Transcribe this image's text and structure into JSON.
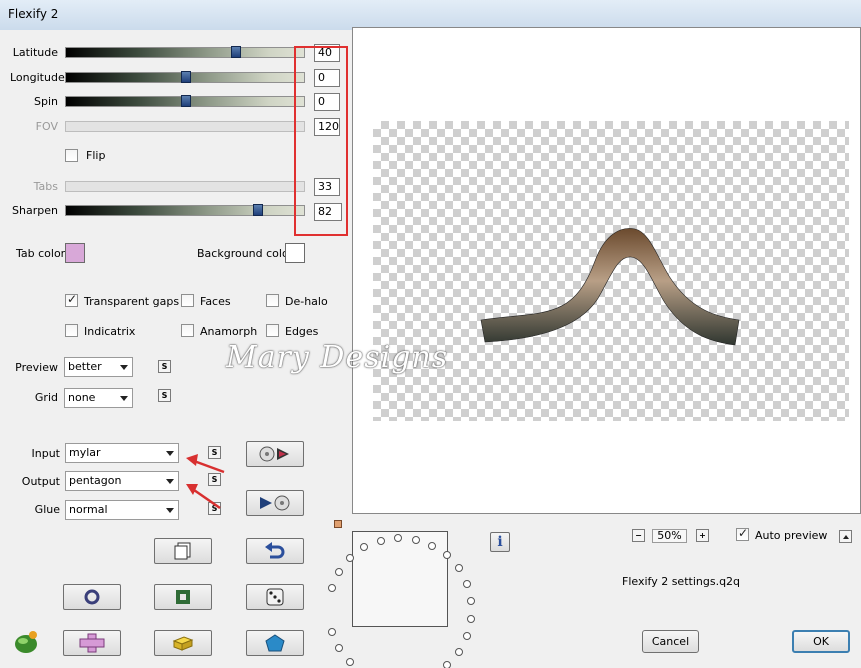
{
  "window": {
    "title": "Flexify 2"
  },
  "sliders": [
    {
      "label": "Latitude",
      "value": "40",
      "enabled": true,
      "level": 0.72
    },
    {
      "label": "Longitude",
      "value": "0",
      "enabled": true,
      "level": 0.5
    },
    {
      "label": "Spin",
      "value": "0",
      "enabled": true,
      "level": 0.5
    },
    {
      "label": "FOV",
      "value": "120",
      "enabled": false
    },
    {
      "label": "Tabs",
      "value": "33",
      "enabled": false
    },
    {
      "label": "Sharpen",
      "value": "82",
      "enabled": true,
      "level": 0.82
    }
  ],
  "flip": {
    "label": "Flip",
    "checked": false
  },
  "colors": {
    "tab_label": "Tab color",
    "tab_swatch": "#d8a8d8",
    "bg_label": "Background color",
    "bg_swatch": "#ffffff",
    "annotation": "#e03030"
  },
  "options": {
    "transparent_gaps": {
      "label": "Transparent gaps",
      "checked": true
    },
    "faces": {
      "label": "Faces",
      "checked": false
    },
    "de_halo": {
      "label": "De-halo",
      "checked": false
    },
    "indicatrix": {
      "label": "Indicatrix",
      "checked": false
    },
    "anamorph": {
      "label": "Anamorph",
      "checked": false
    },
    "edges": {
      "label": "Edges",
      "checked": false
    }
  },
  "preview_select": {
    "label": "Preview",
    "value": "better"
  },
  "grid_select": {
    "label": "Grid",
    "value": "none"
  },
  "input_select": {
    "label": "Input",
    "value": "mylar"
  },
  "output_select": {
    "label": "Output",
    "value": "pentagon"
  },
  "glue_select": {
    "label": "Glue",
    "value": "normal"
  },
  "s_button": "S",
  "zoom": {
    "value": "50%",
    "minus": "−",
    "plus": "+"
  },
  "auto_preview": {
    "label": "Auto preview",
    "checked": true
  },
  "settings_file": "Flexify 2 settings.q2q",
  "watermark": "Mary Designs",
  "buttons": {
    "cancel": "Cancel",
    "ok": "OK"
  }
}
